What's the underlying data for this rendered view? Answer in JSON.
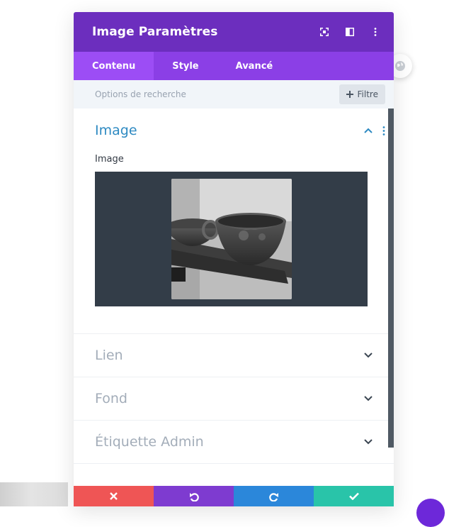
{
  "modal": {
    "title": "Image Paramètres",
    "tabs": [
      {
        "label": "Contenu",
        "active": true
      },
      {
        "label": "Style",
        "active": false
      },
      {
        "label": "Avancé",
        "active": false
      }
    ],
    "search": {
      "placeholder": "Options de recherche"
    },
    "filter_label": "Filtre",
    "sections": {
      "image": {
        "title": "Image",
        "field_label": "Image",
        "expanded": true
      },
      "link": {
        "title": "Lien",
        "expanded": false
      },
      "background": {
        "title": "Fond",
        "expanded": false
      },
      "admin_label": {
        "title": "Étiquette Admin",
        "expanded": false
      }
    }
  },
  "colors": {
    "header": "#6c2ebe",
    "tabs": "#8b3fe6",
    "cancel": "#ef5555",
    "undo": "#7e3bd0",
    "redo": "#2b87da",
    "save": "#29c4a9"
  },
  "icons": {
    "header": [
      "fullscreen-icon",
      "split-view-icon",
      "more-vertical-icon"
    ],
    "footer": [
      "close-icon",
      "undo-icon",
      "redo-icon",
      "check-icon"
    ]
  }
}
